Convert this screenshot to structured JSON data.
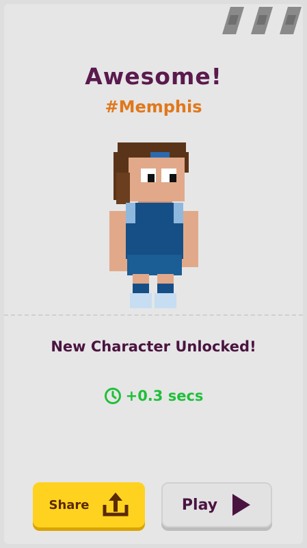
{
  "header": {
    "title": "Awesome!",
    "subtitle": "#Memphis",
    "tickets_icon": "ticket-icon"
  },
  "character": {
    "name": "Memphis"
  },
  "reward": {
    "unlock_text": "New Character Unlocked!",
    "time_bonus": "+0.3 secs",
    "icon": "clock-icon"
  },
  "actions": {
    "share_label": "Share",
    "play_label": "Play"
  },
  "colors": {
    "title": "#5a1a4e",
    "tag": "#e0781c",
    "bonus": "#1fbf3a",
    "share_button": "#ffd21f",
    "play_button": "#e2e2e2"
  }
}
